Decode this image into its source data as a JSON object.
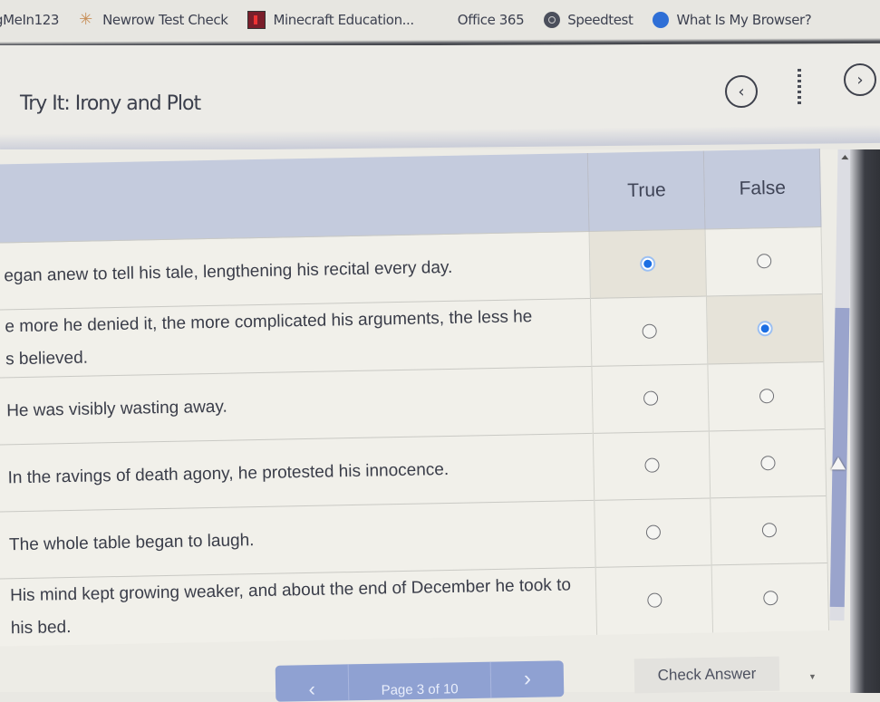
{
  "bookmarks": [
    {
      "label": "gMeIn123",
      "icon": "logmein-icon"
    },
    {
      "label": "Newrow Test Check",
      "icon": "newrow-icon"
    },
    {
      "label": "Minecraft Education...",
      "icon": "minecraft-education-icon"
    },
    {
      "label": "Office 365",
      "icon": "office-365-icon"
    },
    {
      "label": "Speedtest",
      "icon": "speedtest-icon"
    },
    {
      "label": "What Is My Browser?",
      "icon": "whatismybrowser-icon"
    }
  ],
  "header": {
    "title": "Try It: Irony and Plot",
    "prev_icon": "‹",
    "next_icon": "›"
  },
  "table": {
    "columns": [
      "True",
      "False"
    ],
    "rows": [
      {
        "statement": "He began anew to tell his tale, lengthening his recital every day.",
        "visible": "egan anew to tell his tale, lengthening his recital every day.",
        "selected": "True"
      },
      {
        "statement": "The more he denied it, the more complicated his arguments, the less he was believed.",
        "visible": "e more he denied it, the more complicated his arguments, the less he\ns believed.",
        "selected": "False"
      },
      {
        "statement": "He was visibly wasting away.",
        "visible": "He was visibly wasting away.",
        "selected": null
      },
      {
        "statement": "In the ravings of death agony, he protested his innocence.",
        "visible": "In the ravings of death agony, he protested his innocence.",
        "selected": null
      },
      {
        "statement": "The whole table began to laugh.",
        "visible": "The whole table began to laugh.",
        "selected": null
      },
      {
        "statement": "His mind kept growing weaker, and about the end of December he took to his bed.",
        "visible": "His mind kept growing weaker, and about the end of December he took to his bed.",
        "selected": null
      }
    ]
  },
  "pager": {
    "label": "Page 3 of 10",
    "current": 3,
    "total": 10,
    "prev_icon": "‹",
    "next_icon": "›"
  },
  "actions": {
    "check_answer": "Check Answer"
  },
  "colors": {
    "header_bg": "#c4cbdd",
    "accent": "#1c6fe3",
    "pager_bg": "#8fa1d2",
    "scroll_thumb": "#9aa4cc"
  }
}
